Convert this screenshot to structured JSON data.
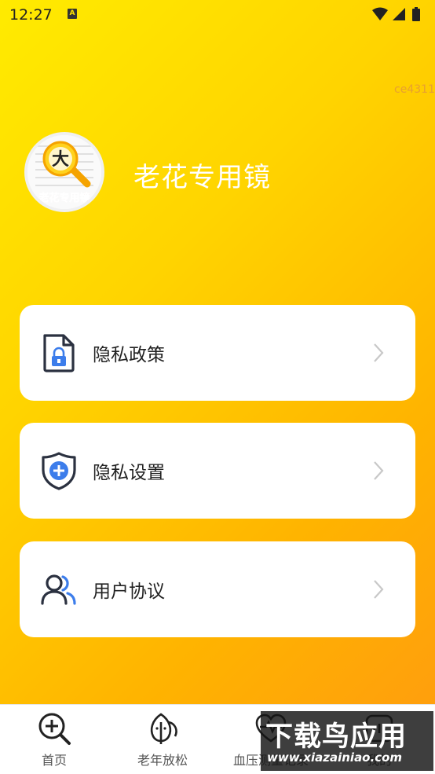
{
  "status_bar": {
    "time": "12:27",
    "notification_badge": "A",
    "icons": [
      "wifi-icon",
      "signal-icon",
      "battery-icon"
    ]
  },
  "watermark_text": "ce4311",
  "profile": {
    "avatar_text": "大",
    "avatar_caption": "老花专用镜",
    "app_name": "老花专用镜"
  },
  "menu": {
    "items": [
      {
        "label": "隐私政策",
        "icon": "document-lock-icon"
      },
      {
        "label": "隐私设置",
        "icon": "shield-plus-icon"
      },
      {
        "label": "用户协议",
        "icon": "users-icon"
      }
    ]
  },
  "tabbar": {
    "tabs": [
      {
        "label": "首页",
        "icon": "zoom-in-icon"
      },
      {
        "label": "老年放松",
        "icon": "leaf-face-icon"
      },
      {
        "label": "血压测量记录",
        "icon": "heart-pulse-icon"
      },
      {
        "label": "我的",
        "icon": "profile-icon"
      }
    ]
  },
  "overlay_watermark": {
    "title": "下载鸟应用",
    "url": "www.xiazainiao.com"
  },
  "colors": {
    "gradient_start": "#FFEB00",
    "gradient_end": "#FF9A10",
    "icon_blue": "#3C7DEB",
    "icon_dark": "#2B3140"
  }
}
